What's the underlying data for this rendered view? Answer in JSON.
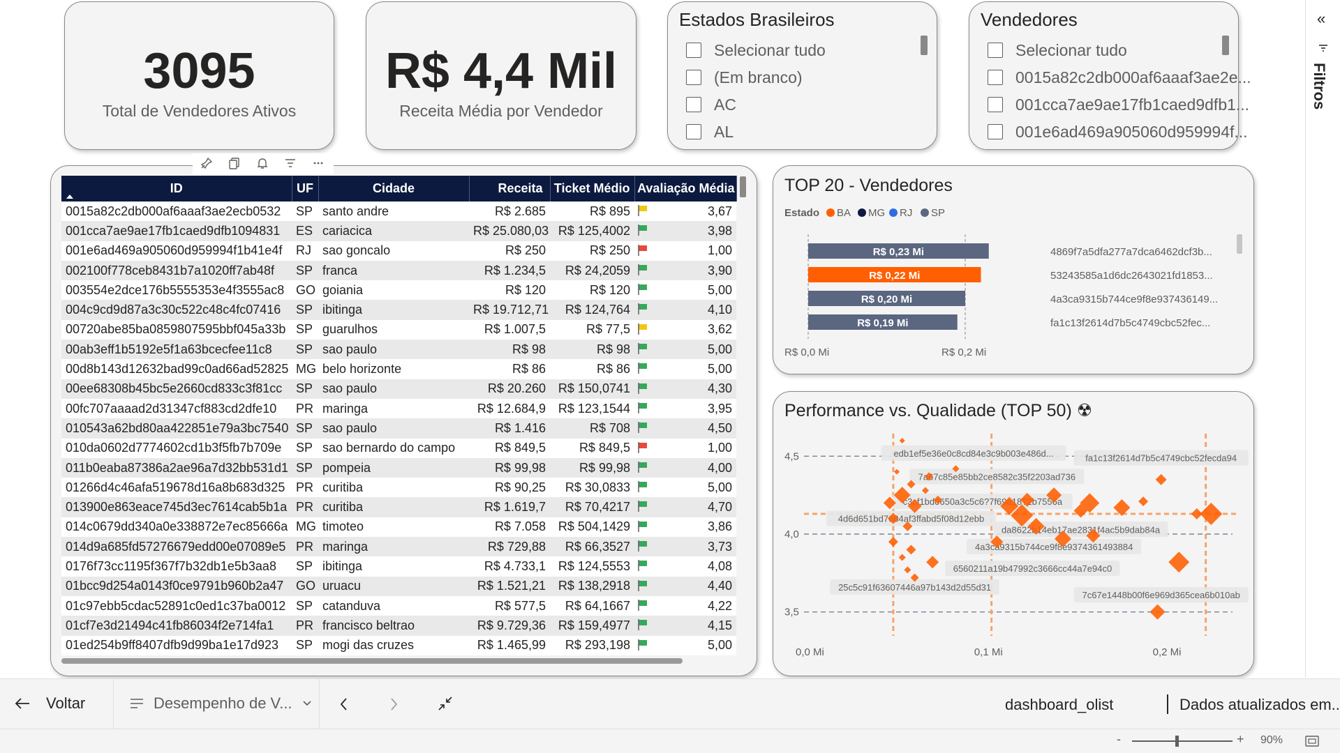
{
  "kpis": [
    {
      "value": "3095",
      "label": "Total de Vendedores Ativos"
    },
    {
      "value": "R$ 4,4 Mil",
      "label": "Receita Média por Vendedor"
    }
  ],
  "slicers": {
    "estados": {
      "title": "Estados Brasileiros",
      "items": [
        "Selecionar tudo",
        "(Em branco)",
        "AC",
        "AL"
      ]
    },
    "vendedores": {
      "title": "Vendedores",
      "items": [
        "Selecionar tudo",
        "0015a82c2db000af6aaaf3ae2e...",
        "001cca7ae9ae17fb1caed9dfb1...",
        "001e6ad469a905060d959994f..."
      ]
    }
  },
  "table": {
    "columns": [
      "ID",
      "UF",
      "Cidade",
      "Receita",
      "Ticket Médio",
      "Avaliação Média"
    ],
    "sort_icon": "sort-ascending-icon",
    "flag_colors": {
      "green": "#37a85a",
      "yellow": "#f2c80f",
      "red": "#e8483d"
    },
    "rows": [
      {
        "id": "0015a82c2db000af6aaaf3ae2ecb0532",
        "uf": "SP",
        "cidade": "santo andre",
        "receita": "R$ 2.685",
        "ticket": "R$ 895",
        "flag": "yellow",
        "aval": "3,67"
      },
      {
        "id": "001cca7ae9ae17fb1caed9dfb1094831",
        "uf": "ES",
        "cidade": "cariacica",
        "receita": "R$ 25.080,03",
        "ticket": "R$ 125,4002",
        "flag": "green",
        "aval": "3,98"
      },
      {
        "id": "001e6ad469a905060d959994f1b41e4f",
        "uf": "RJ",
        "cidade": "sao goncalo",
        "receita": "R$ 250",
        "ticket": "R$ 250",
        "flag": "red",
        "aval": "1,00"
      },
      {
        "id": "002100f778ceb8431b7a1020ff7ab48f",
        "uf": "SP",
        "cidade": "franca",
        "receita": "R$ 1.234,5",
        "ticket": "R$ 24,2059",
        "flag": "green",
        "aval": "3,90"
      },
      {
        "id": "003554e2dce176b5555353e4f3555ac8",
        "uf": "GO",
        "cidade": "goiania",
        "receita": "R$ 120",
        "ticket": "R$ 120",
        "flag": "green",
        "aval": "5,00"
      },
      {
        "id": "004c9cd9d87a3c30c522c48c4fc07416",
        "uf": "SP",
        "cidade": "ibitinga",
        "receita": "R$ 19.712,71",
        "ticket": "R$ 124,764",
        "flag": "green",
        "aval": "4,10"
      },
      {
        "id": "00720abe85ba0859807595bbf045a33b",
        "uf": "SP",
        "cidade": "guarulhos",
        "receita": "R$ 1.007,5",
        "ticket": "R$ 77,5",
        "flag": "yellow",
        "aval": "3,62"
      },
      {
        "id": "00ab3eff1b5192e5f1a63bcecfee11c8",
        "uf": "SP",
        "cidade": "sao paulo",
        "receita": "R$ 98",
        "ticket": "R$ 98",
        "flag": "green",
        "aval": "5,00"
      },
      {
        "id": "00d8b143d12632bad99c0ad66ad52825",
        "uf": "MG",
        "cidade": "belo horizonte",
        "receita": "R$ 86",
        "ticket": "R$ 86",
        "flag": "green",
        "aval": "5,00"
      },
      {
        "id": "00ee68308b45bc5e2660cd833c3f81cc",
        "uf": "SP",
        "cidade": "sao paulo",
        "receita": "R$ 20.260",
        "ticket": "R$ 150,0741",
        "flag": "green",
        "aval": "4,30"
      },
      {
        "id": "00fc707aaaad2d31347cf883cd2dfe10",
        "uf": "PR",
        "cidade": "maringa",
        "receita": "R$ 12.684,9",
        "ticket": "R$ 123,1544",
        "flag": "green",
        "aval": "3,95"
      },
      {
        "id": "010543a62bd80aa422851e79a3bc7540",
        "uf": "SP",
        "cidade": "sao paulo",
        "receita": "R$ 1.416",
        "ticket": "R$ 708",
        "flag": "green",
        "aval": "4,50"
      },
      {
        "id": "010da0602d7774602cd1b3f5fb7b709e",
        "uf": "SP",
        "cidade": "sao bernardo do campo",
        "receita": "R$ 849,5",
        "ticket": "R$ 849,5",
        "flag": "red",
        "aval": "1,00"
      },
      {
        "id": "011b0eaba87386a2ae96a7d32bb531d1",
        "uf": "SP",
        "cidade": "pompeia",
        "receita": "R$ 99,98",
        "ticket": "R$ 99,98",
        "flag": "green",
        "aval": "4,00"
      },
      {
        "id": "01266d4c46afa519678d16a8b683d325",
        "uf": "PR",
        "cidade": "curitiba",
        "receita": "R$ 90,25",
        "ticket": "R$ 30,0833",
        "flag": "green",
        "aval": "5,00"
      },
      {
        "id": "013900e863eace745d3ec7614cab5b1a",
        "uf": "PR",
        "cidade": "curitiba",
        "receita": "R$ 1.619,7",
        "ticket": "R$ 70,4217",
        "flag": "green",
        "aval": "4,70"
      },
      {
        "id": "014c0679dd340a0e338872e7ec85666a",
        "uf": "MG",
        "cidade": "timoteo",
        "receita": "R$ 7.058",
        "ticket": "R$ 504,1429",
        "flag": "green",
        "aval": "3,86"
      },
      {
        "id": "014d9a685fd57276679edd00e07089e5",
        "uf": "PR",
        "cidade": "maringa",
        "receita": "R$ 729,88",
        "ticket": "R$ 66,3527",
        "flag": "green",
        "aval": "3,73"
      },
      {
        "id": "0176f73cc1195f367f7b32db1e5b3aa8",
        "uf": "SP",
        "cidade": "ibitinga",
        "receita": "R$ 4.733,1",
        "ticket": "R$ 124,5553",
        "flag": "green",
        "aval": "4,08"
      },
      {
        "id": "01bcc9d254a0143f0ce9791b960b2a47",
        "uf": "GO",
        "cidade": "uruacu",
        "receita": "R$ 1.521,21",
        "ticket": "R$ 138,2918",
        "flag": "green",
        "aval": "4,40"
      },
      {
        "id": "01c97ebb5cdac52891c0ed1c37ba0012",
        "uf": "SP",
        "cidade": "catanduva",
        "receita": "R$ 577,5",
        "ticket": "R$ 64,1667",
        "flag": "green",
        "aval": "4,22"
      },
      {
        "id": "01cf7e3d21494c41fb86034f2e714fa1",
        "uf": "PR",
        "cidade": "francisco beltrao",
        "receita": "R$ 9.729,36",
        "ticket": "R$ 159,4977",
        "flag": "green",
        "aval": "4,15"
      },
      {
        "id": "01ed254b9ff8407dfb9d99ba1e17d923",
        "uf": "SP",
        "cidade": "mogi das cruzes",
        "receita": "R$ 1.465,99",
        "ticket": "R$ 293,198",
        "flag": "green",
        "aval": "5,00"
      }
    ]
  },
  "top20": {
    "title": "TOP 20 - Vendedores",
    "legend_title": "Estado",
    "legend": [
      {
        "name": "BA",
        "color": "#ff5f00"
      },
      {
        "name": "MG",
        "color": "#0c1a40"
      },
      {
        "name": "RJ",
        "color": "#2f6fe0"
      },
      {
        "name": "SP",
        "color": "#5b6680"
      }
    ],
    "chart_data": {
      "type": "bar",
      "orientation": "horizontal",
      "categories": [
        "4869f7a5dfa277a7dca6462dcf3b...",
        "53243585a1d6dc2643021fd1853...",
        "4a3ca9315b744ce9f8e937436149...",
        "fa1c13f2614d7b5c4749cbc52fec..."
      ],
      "values": [
        0.23,
        0.22,
        0.2,
        0.19
      ],
      "data_labels": [
        "R$ 0,23 Mi",
        "R$ 0,22 Mi",
        "R$ 0,20 Mi",
        "R$ 0,19 Mi"
      ],
      "colors": [
        "#5b6680",
        "#ff5f00",
        "#5b6680",
        "#5b6680"
      ],
      "xlim": [
        0,
        0.28
      ],
      "x_ticks": [
        0,
        0.2
      ],
      "x_tick_labels": [
        "R$ 0,0 Mi",
        "R$ 0,2 Mi"
      ]
    }
  },
  "scatter": {
    "title": "Performance vs. Qualidade (TOP 50)",
    "title_icon": "radioactive-icon",
    "chart_data": {
      "type": "scatter",
      "xlim": [
        0,
        0.24
      ],
      "ylim": [
        3.4,
        4.6
      ],
      "x_ticks": [
        0,
        0.1,
        0.2
      ],
      "x_tick_labels": [
        "0,0 Mi",
        "0,1 Mi",
        "0,2 Mi"
      ],
      "y_ticks": [
        3.5,
        4.0,
        4.5
      ],
      "y_tick_labels": [
        "3,5",
        "4,0",
        "4,5"
      ],
      "reference_lines": {
        "x": [
          0.05,
          0.105,
          0.225
        ],
        "y": 4.13
      },
      "color": "#ff5f00",
      "points": [
        {
          "x": 0.055,
          "y": 4.6,
          "s": 4
        },
        {
          "x": 0.052,
          "y": 4.4,
          "s": 4
        },
        {
          "x": 0.07,
          "y": 4.37,
          "s": 6
        },
        {
          "x": 0.085,
          "y": 4.42,
          "s": 5
        },
        {
          "x": 0.06,
          "y": 4.32,
          "s": 6
        },
        {
          "x": 0.048,
          "y": 4.2,
          "s": 9
        },
        {
          "x": 0.055,
          "y": 4.25,
          "s": 12
        },
        {
          "x": 0.062,
          "y": 4.18,
          "s": 10
        },
        {
          "x": 0.05,
          "y": 4.1,
          "s": 8
        },
        {
          "x": 0.058,
          "y": 4.05,
          "s": 7
        },
        {
          "x": 0.075,
          "y": 4.22,
          "s": 6
        },
        {
          "x": 0.068,
          "y": 4.28,
          "s": 5
        },
        {
          "x": 0.05,
          "y": 3.95,
          "s": 7
        },
        {
          "x": 0.06,
          "y": 3.9,
          "s": 7
        },
        {
          "x": 0.055,
          "y": 3.85,
          "s": 5
        },
        {
          "x": 0.072,
          "y": 3.82,
          "s": 9
        },
        {
          "x": 0.058,
          "y": 3.77,
          "s": 5
        },
        {
          "x": 0.062,
          "y": 3.72,
          "s": 6
        },
        {
          "x": 0.115,
          "y": 4.18,
          "s": 13
        },
        {
          "x": 0.122,
          "y": 4.12,
          "s": 16
        },
        {
          "x": 0.13,
          "y": 4.05,
          "s": 12
        },
        {
          "x": 0.125,
          "y": 4.22,
          "s": 10
        },
        {
          "x": 0.14,
          "y": 4.25,
          "s": 11
        },
        {
          "x": 0.16,
          "y": 4.2,
          "s": 14
        },
        {
          "x": 0.155,
          "y": 4.15,
          "s": 10
        },
        {
          "x": 0.178,
          "y": 4.17,
          "s": 12
        },
        {
          "x": 0.19,
          "y": 4.21,
          "s": 7
        },
        {
          "x": 0.145,
          "y": 3.97,
          "s": 12
        },
        {
          "x": 0.162,
          "y": 3.99,
          "s": 10
        },
        {
          "x": 0.108,
          "y": 3.95,
          "s": 9
        },
        {
          "x": 0.2,
          "y": 4.35,
          "s": 8
        },
        {
          "x": 0.228,
          "y": 4.13,
          "s": 16
        },
        {
          "x": 0.22,
          "y": 4.13,
          "s": 8
        },
        {
          "x": 0.21,
          "y": 3.82,
          "s": 15
        },
        {
          "x": 0.198,
          "y": 3.5,
          "s": 11
        }
      ],
      "annotations": [
        {
          "text": "edb1ef5e36e0c8cd84e3c9b003e486d...",
          "x": 0.095,
          "y": 4.52
        },
        {
          "text": "fa1c13f2614d7b5c4749cbc52fecda94",
          "x": 0.2,
          "y": 4.49
        },
        {
          "text": "7a67c85e85bb2ce8582c35f2203ad736",
          "x": 0.108,
          "y": 4.37
        },
        {
          "text": "c3cf1bd0650a3c5c6?7f69a18?2b7556a",
          "x": 0.1,
          "y": 4.21
        },
        {
          "text": "4d6d651bd7684af3ffabd5f08d12ebb",
          "x": 0.06,
          "y": 4.1
        },
        {
          "text": "da8622b14eb17ae2831f4ac5b9dab84a",
          "x": 0.155,
          "y": 4.03
        },
        {
          "text": "4a3ca9315b744ce9f8e9374361493884",
          "x": 0.14,
          "y": 3.92
        },
        {
          "text": "6560211a19b47992c3666cc44a7e94c0",
          "x": 0.128,
          "y": 3.78
        },
        {
          "text": "25c5c91f63607446a97b143d2d55d31",
          "x": 0.062,
          "y": 3.66
        },
        {
          "text": "7c67e1448b00f6e969d365cea6b010ab",
          "x": 0.2,
          "y": 3.61
        }
      ]
    }
  },
  "bottom": {
    "back_label": "Voltar",
    "page_label": "Desempenho de V...",
    "dataset": "dashboard_olist",
    "updated": "Dados atualizados em...",
    "zoom": "90%",
    "zoom_minus": "-",
    "zoom_plus": "+"
  },
  "filters_label": "Filtros",
  "collapse_glyph": "«"
}
